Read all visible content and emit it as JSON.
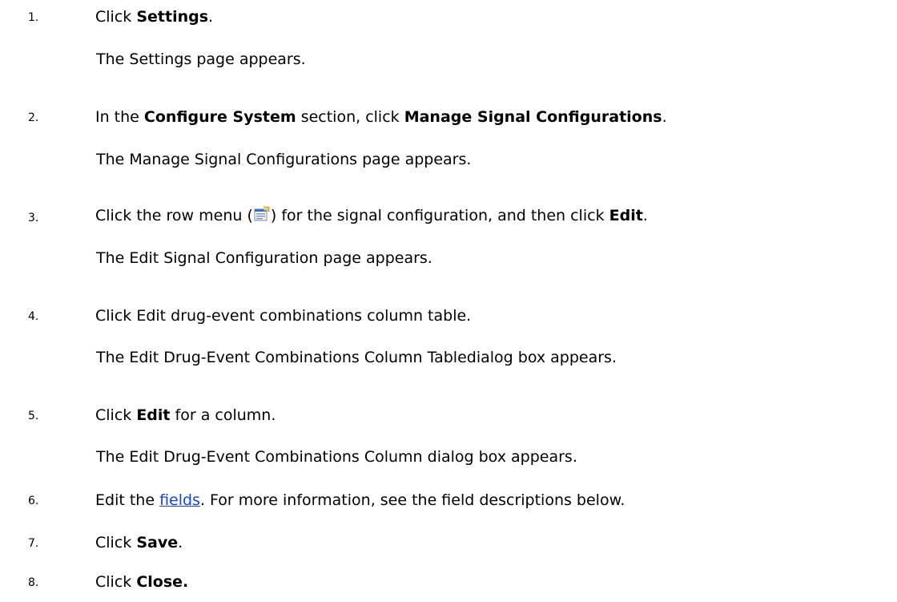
{
  "steps": [
    {
      "number": "1.",
      "before": "Click ",
      "bold": "Settings",
      "after": ".",
      "result": "The Settings page appears."
    },
    {
      "number": "2.",
      "t1": "In the ",
      "b1": "Configure System",
      "t2": " section, click ",
      "b2": "Manage Signal Configurations",
      "t3": ".",
      "result": "The Manage Signal Configurations page appears."
    },
    {
      "number": "3.",
      "t1": "Click the row menu (",
      "t2": ") for the signal configuration, and then click ",
      "b1": "Edit",
      "t3": ".",
      "icon": "row-menu-icon",
      "result": "The Edit Signal Configuration page appears."
    },
    {
      "number": "4.",
      "text": "Click Edit drug-event combinations column table.",
      "result": "The Edit Drug-Event Combinations Column Tabledialog box appears."
    },
    {
      "number": "5.",
      "before": "Click ",
      "bold": "Edit",
      "after": " for a column.",
      "result": "The Edit Drug-Event Combinations Column dialog box appears."
    },
    {
      "number": "6.",
      "before": "Edit the ",
      "link": "fields",
      "after": ". For more information, see the field descriptions below."
    },
    {
      "number": "7.",
      "before": "Click ",
      "bold": "Save",
      "after": "."
    },
    {
      "number": "8.",
      "before": "Click ",
      "bold": "Close."
    }
  ],
  "colors": {
    "link": "#1a45c8",
    "text": "#000000"
  }
}
